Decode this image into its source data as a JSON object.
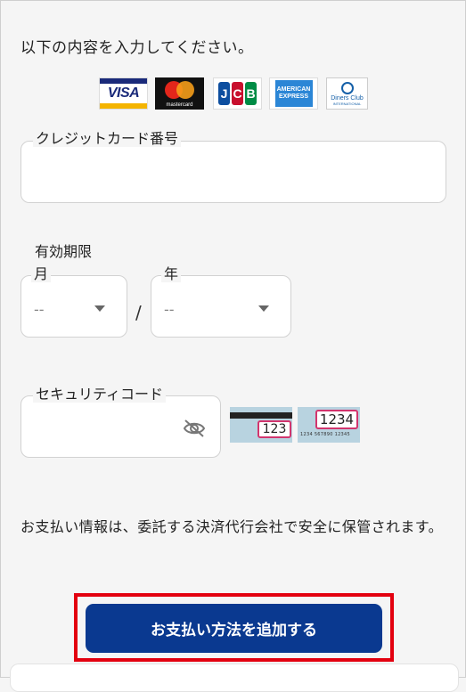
{
  "form": {
    "intro": "以下の内容を入力してください。",
    "card_number_label": "クレジットカード番号",
    "expiry_label": "有効期限",
    "month_label": "月",
    "month_value": "--",
    "year_label": "年",
    "year_value": "--",
    "separator": "/",
    "security_code_label": "セキュリティコード",
    "notice": "お支払い情報は、委託する決済代行会社で安全に保管されます。",
    "submit_label": "お支払い方法を追加する"
  },
  "brands": {
    "visa": "VISA",
    "mastercard": "mastercard",
    "jcb": [
      "J",
      "C",
      "B"
    ],
    "amex_line1": "AMERICAN",
    "amex_line2": "EXPRESS",
    "diners_line1": "Diners Club",
    "diners_line2": "INTERNATIONAL"
  },
  "cvv_examples": {
    "back_code": "123",
    "front_code": "1234",
    "front_number": "1234 567890 12345"
  },
  "icons": {
    "visibility_toggle": "eye-off-icon",
    "dropdown": "caret-down-icon"
  },
  "colors": {
    "primary_button": "#0a3990",
    "highlight_border": "#e3000f",
    "cvv_box_border": "#d2356e"
  }
}
